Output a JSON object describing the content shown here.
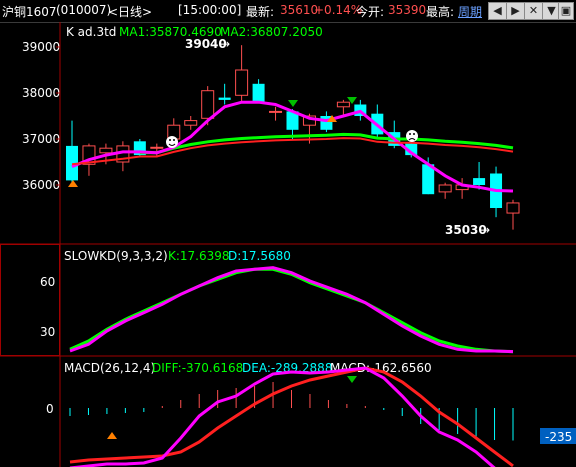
{
  "titlebar": {
    "symbol": "沪铜1607",
    "code": "(010007)",
    "period": "<日线>",
    "time": "[15:00:00]",
    "latest_label": "最新:",
    "latest_value": "35610",
    "change_pct": "+0.14%",
    "open_label": "今开:",
    "open_value": "35390",
    "high_label": "最高:",
    "cycle_link": "周期",
    "buttons": [
      "◀",
      "▶",
      "✕",
      "▼",
      "▣"
    ]
  },
  "colors": {
    "up": "#ff4f4f",
    "down": "#00ffff",
    "ma1": "#ff00ff",
    "ma2": "#00ff00",
    "k_line": "#ff00ff",
    "red_line": "#ff2020",
    "axis": "#a00000",
    "label": "#ffffff",
    "diff": "#00ff00",
    "dea": "#00ffff",
    "macd": "#ffffff"
  },
  "main_panel": {
    "legend_k": "K  ad.3td",
    "ma1": "MA1:35870.4690",
    "ma2": "MA2:36807.2050",
    "high_annot": "39040",
    "low_annot": "35030",
    "y_ticks": [
      "39000",
      "38000",
      "37000",
      "36000"
    ]
  },
  "kd_panel": {
    "title": "SLOWKD(9,3,3,2)",
    "k": "K:17.6398",
    "d": "D:17.5680",
    "y_ticks": [
      "60",
      "30"
    ]
  },
  "macd_panel": {
    "title": "MACD(26,12,4)",
    "diff": "DIFF:-370.6168",
    "dea": "DEA:-289.2888",
    "macd": "MACD:-162.6560",
    "y_ticks": [
      "0"
    ],
    "current_badge": "-235"
  },
  "chart_data": {
    "type": "candlestick",
    "candles": [
      {
        "o": 36850,
        "h": 37400,
        "l": 36020,
        "c": 36100
      },
      {
        "o": 36450,
        "h": 36900,
        "l": 36200,
        "c": 36850
      },
      {
        "o": 36700,
        "h": 36900,
        "l": 36450,
        "c": 36800
      },
      {
        "o": 36500,
        "h": 36950,
        "l": 36300,
        "c": 36850
      },
      {
        "o": 36950,
        "h": 37000,
        "l": 36600,
        "c": 36650
      },
      {
        "o": 36800,
        "h": 36900,
        "l": 36600,
        "c": 36820
      },
      {
        "o": 37000,
        "h": 37450,
        "l": 36900,
        "c": 37300
      },
      {
        "o": 37300,
        "h": 37500,
        "l": 37200,
        "c": 37400
      },
      {
        "o": 37450,
        "h": 38150,
        "l": 37300,
        "c": 38050
      },
      {
        "o": 37900,
        "h": 38200,
        "l": 37750,
        "c": 37850
      },
      {
        "o": 37950,
        "h": 39040,
        "l": 37800,
        "c": 38500
      },
      {
        "o": 38200,
        "h": 38300,
        "l": 37800,
        "c": 37800
      },
      {
        "o": 37600,
        "h": 37700,
        "l": 37400,
        "c": 37600
      },
      {
        "o": 37600,
        "h": 37650,
        "l": 37000,
        "c": 37200
      },
      {
        "o": 37300,
        "h": 37550,
        "l": 36900,
        "c": 37500
      },
      {
        "o": 37500,
        "h": 37600,
        "l": 37150,
        "c": 37200
      },
      {
        "o": 37700,
        "h": 37850,
        "l": 37500,
        "c": 37800
      },
      {
        "o": 37750,
        "h": 37850,
        "l": 37400,
        "c": 37500
      },
      {
        "o": 37550,
        "h": 37750,
        "l": 37000,
        "c": 37100
      },
      {
        "o": 37150,
        "h": 37400,
        "l": 36800,
        "c": 36850
      },
      {
        "o": 36900,
        "h": 37000,
        "l": 36600,
        "c": 36650
      },
      {
        "o": 36450,
        "h": 36600,
        "l": 35800,
        "c": 35800
      },
      {
        "o": 35850,
        "h": 36050,
        "l": 35700,
        "c": 36000
      },
      {
        "o": 35900,
        "h": 36150,
        "l": 35700,
        "c": 36000
      },
      {
        "o": 36150,
        "h": 36500,
        "l": 35900,
        "c": 36000
      },
      {
        "o": 36250,
        "h": 36400,
        "l": 35300,
        "c": 35500
      },
      {
        "o": 35390,
        "h": 35680,
        "l": 35030,
        "c": 35610
      }
    ],
    "ma1": [
      36400,
      36550,
      36650,
      36720,
      36720,
      36700,
      36820,
      37050,
      37400,
      37700,
      37800,
      37800,
      37750,
      37600,
      37450,
      37400,
      37500,
      37600,
      37300,
      37000,
      36700,
      36450,
      36200,
      36000,
      35950,
      35880,
      35870
    ],
    "ma2": [
      null,
      null,
      null,
      null,
      36700,
      36700,
      36800,
      36880,
      36940,
      36980,
      37010,
      37030,
      37050,
      37060,
      37070,
      37080,
      37100,
      37090,
      37020,
      37000,
      37000,
      36980,
      36950,
      36930,
      36900,
      36860,
      36807
    ],
    "kd": {
      "k": [
        18,
        22,
        30,
        36,
        41,
        46,
        52,
        57,
        62,
        66,
        67,
        68,
        65,
        60,
        56,
        52,
        47,
        40,
        33,
        27,
        22,
        19,
        18,
        18,
        17.6398
      ],
      "d": [
        19,
        24,
        31,
        37,
        42,
        47,
        52,
        57,
        61,
        65,
        67,
        67,
        64,
        59,
        55,
        51,
        47,
        41,
        35,
        29,
        24,
        21,
        19,
        18,
        17.568
      ]
    },
    "macd": {
      "diff": [
        -300,
        -290,
        -280,
        -280,
        -275,
        -250,
        -150,
        -40,
        30,
        60,
        120,
        170,
        180,
        175,
        180,
        190,
        200,
        150,
        60,
        -40,
        -120,
        -160,
        -220,
        -300,
        -370.6168
      ],
      "dea": [
        -270,
        -260,
        -255,
        -250,
        -245,
        -240,
        -220,
        -170,
        -100,
        -40,
        20,
        70,
        110,
        140,
        160,
        180,
        200,
        180,
        130,
        60,
        -20,
        -80,
        -150,
        -220,
        -289.2888
      ],
      "hist": [
        -40,
        -35,
        -30,
        -25,
        -20,
        10,
        40,
        70,
        90,
        100,
        110,
        130,
        90,
        70,
        40,
        20,
        10,
        -10,
        -40,
        -80,
        -110,
        -130,
        -150,
        -160,
        -162.656
      ],
      "ylim": [
        -430,
        250
      ]
    }
  }
}
